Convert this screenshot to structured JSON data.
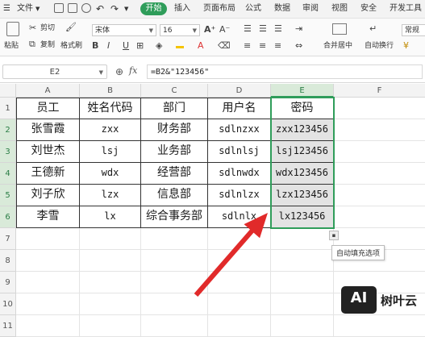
{
  "menubar": {
    "items": [
      "文件",
      "开始",
      "插入",
      "页面布局",
      "公式",
      "数据",
      "审阅",
      "视图",
      "安全",
      "开发工具"
    ],
    "active": "开始"
  },
  "ribbon": {
    "paste": "粘贴",
    "cut": "剪切",
    "copy": "复制",
    "format_painter": "格式刷",
    "font_name": "宋体",
    "font_size": "16",
    "bold": "B",
    "italic": "I",
    "underline": "U",
    "font_color": "A",
    "merge_center": "合并居中",
    "auto_wrap": "自动换行",
    "number_format": "常规"
  },
  "formula_bar": {
    "name_box": "E2",
    "fx": "fx",
    "formula": "=B2&\"123456\""
  },
  "sheet": {
    "columns": [
      "A",
      "B",
      "C",
      "D",
      "E",
      "F"
    ],
    "rows": [
      "1",
      "2",
      "3",
      "4",
      "5",
      "6",
      "7",
      "8",
      "9",
      "10",
      "11"
    ],
    "header": [
      "员工",
      "姓名代码",
      "部门",
      "用户名",
      "密码"
    ],
    "data": [
      [
        "张雪霞",
        "zxx",
        "财务部",
        "sdlnzxx",
        "zxx123456"
      ],
      [
        "刘世杰",
        "lsj",
        "业务部",
        "sdlnlsj",
        "lsj123456"
      ],
      [
        "王德新",
        "wdx",
        "经营部",
        "sdlnwdx",
        "wdx123456"
      ],
      [
        "刘子欣",
        "lzx",
        "信息部",
        "sdlnlzx",
        "lzx123456"
      ],
      [
        "李雪",
        "lx",
        "综合事务部",
        "sdlnlx",
        "lx123456"
      ]
    ],
    "selected_column": "E",
    "selected_cell": "E2"
  },
  "autofill": {
    "button_icon": "autofill-options-icon",
    "tooltip": "自动填充选项"
  },
  "watermark": {
    "logo": "AI",
    "text": "树叶云"
  },
  "colors": {
    "accent": "#2f9d5a",
    "arrow": "#e12a2a",
    "selection_fill": "#e3e3e3"
  }
}
